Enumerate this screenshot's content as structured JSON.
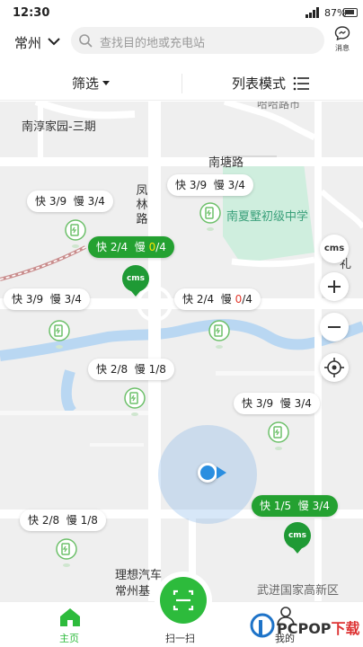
{
  "status_bar": {
    "time": "12:30",
    "battery": "87%"
  },
  "header": {
    "city": "常州",
    "search_placeholder": "查找目的地或充电站",
    "message_label": "消息"
  },
  "filter_bar": {
    "filter_label": "筛选",
    "list_mode_label": "列表模式"
  },
  "map": {
    "labels": {
      "top_cut": "哈哈路市",
      "nanchun": "南淳家园-三期",
      "nantang": "南塘路",
      "fenglin": "凤林路",
      "school": "南夏墅初级中学",
      "right_cut": "礼",
      "district": "武进国家高新区",
      "lixiang": "理想汽车",
      "changzhou_cut": "常州基"
    },
    "stations": [
      {
        "fast": "快 3/9",
        "slow_prefix": "慢 3/4",
        "slow_zero": "",
        "slow_suffix": "",
        "selected": false
      },
      {
        "fast": "快 2/4",
        "slow_prefix": "慢 ",
        "slow_zero": "0",
        "slow_suffix": "/4",
        "selected": true
      },
      {
        "fast": "快 3/9",
        "slow_prefix": "慢 3/4",
        "slow_zero": "",
        "slow_suffix": "",
        "selected": false
      },
      {
        "fast": "快 3/9",
        "slow_prefix": "慢 3/4",
        "slow_zero": "",
        "slow_suffix": "",
        "selected": false
      },
      {
        "fast": "快 2/4",
        "slow_prefix": "慢 ",
        "slow_zero": "0",
        "slow_suffix": "/4",
        "selected": false
      },
      {
        "fast": "快 2/8",
        "slow_prefix": "慢 1/8",
        "slow_zero": "",
        "slow_suffix": "",
        "selected": false
      },
      {
        "fast": "快 3/9",
        "slow_prefix": "慢 3/4",
        "slow_zero": "",
        "slow_suffix": "",
        "selected": false
      },
      {
        "fast": "快 1/5",
        "slow_prefix": "慢 3/4",
        "slow_zero": "",
        "slow_suffix": "",
        "selected": true
      },
      {
        "fast": "快 2/8",
        "slow_prefix": "慢 1/8",
        "slow_zero": "",
        "slow_suffix": "",
        "selected": false
      }
    ],
    "cms_label": "cms",
    "controls": {
      "zoom_in": "+",
      "zoom_out": "−"
    }
  },
  "bottom_nav": {
    "home_label": "主页",
    "scan_label": "扫一扫",
    "mine_label": "我的"
  },
  "watermark": {
    "brand_a": "PCPOP",
    "brand_b": "下载"
  },
  "colors": {
    "brand_green": "#24a131",
    "accent_red": "#e23a2e",
    "location_blue": "#2a8ee0"
  }
}
